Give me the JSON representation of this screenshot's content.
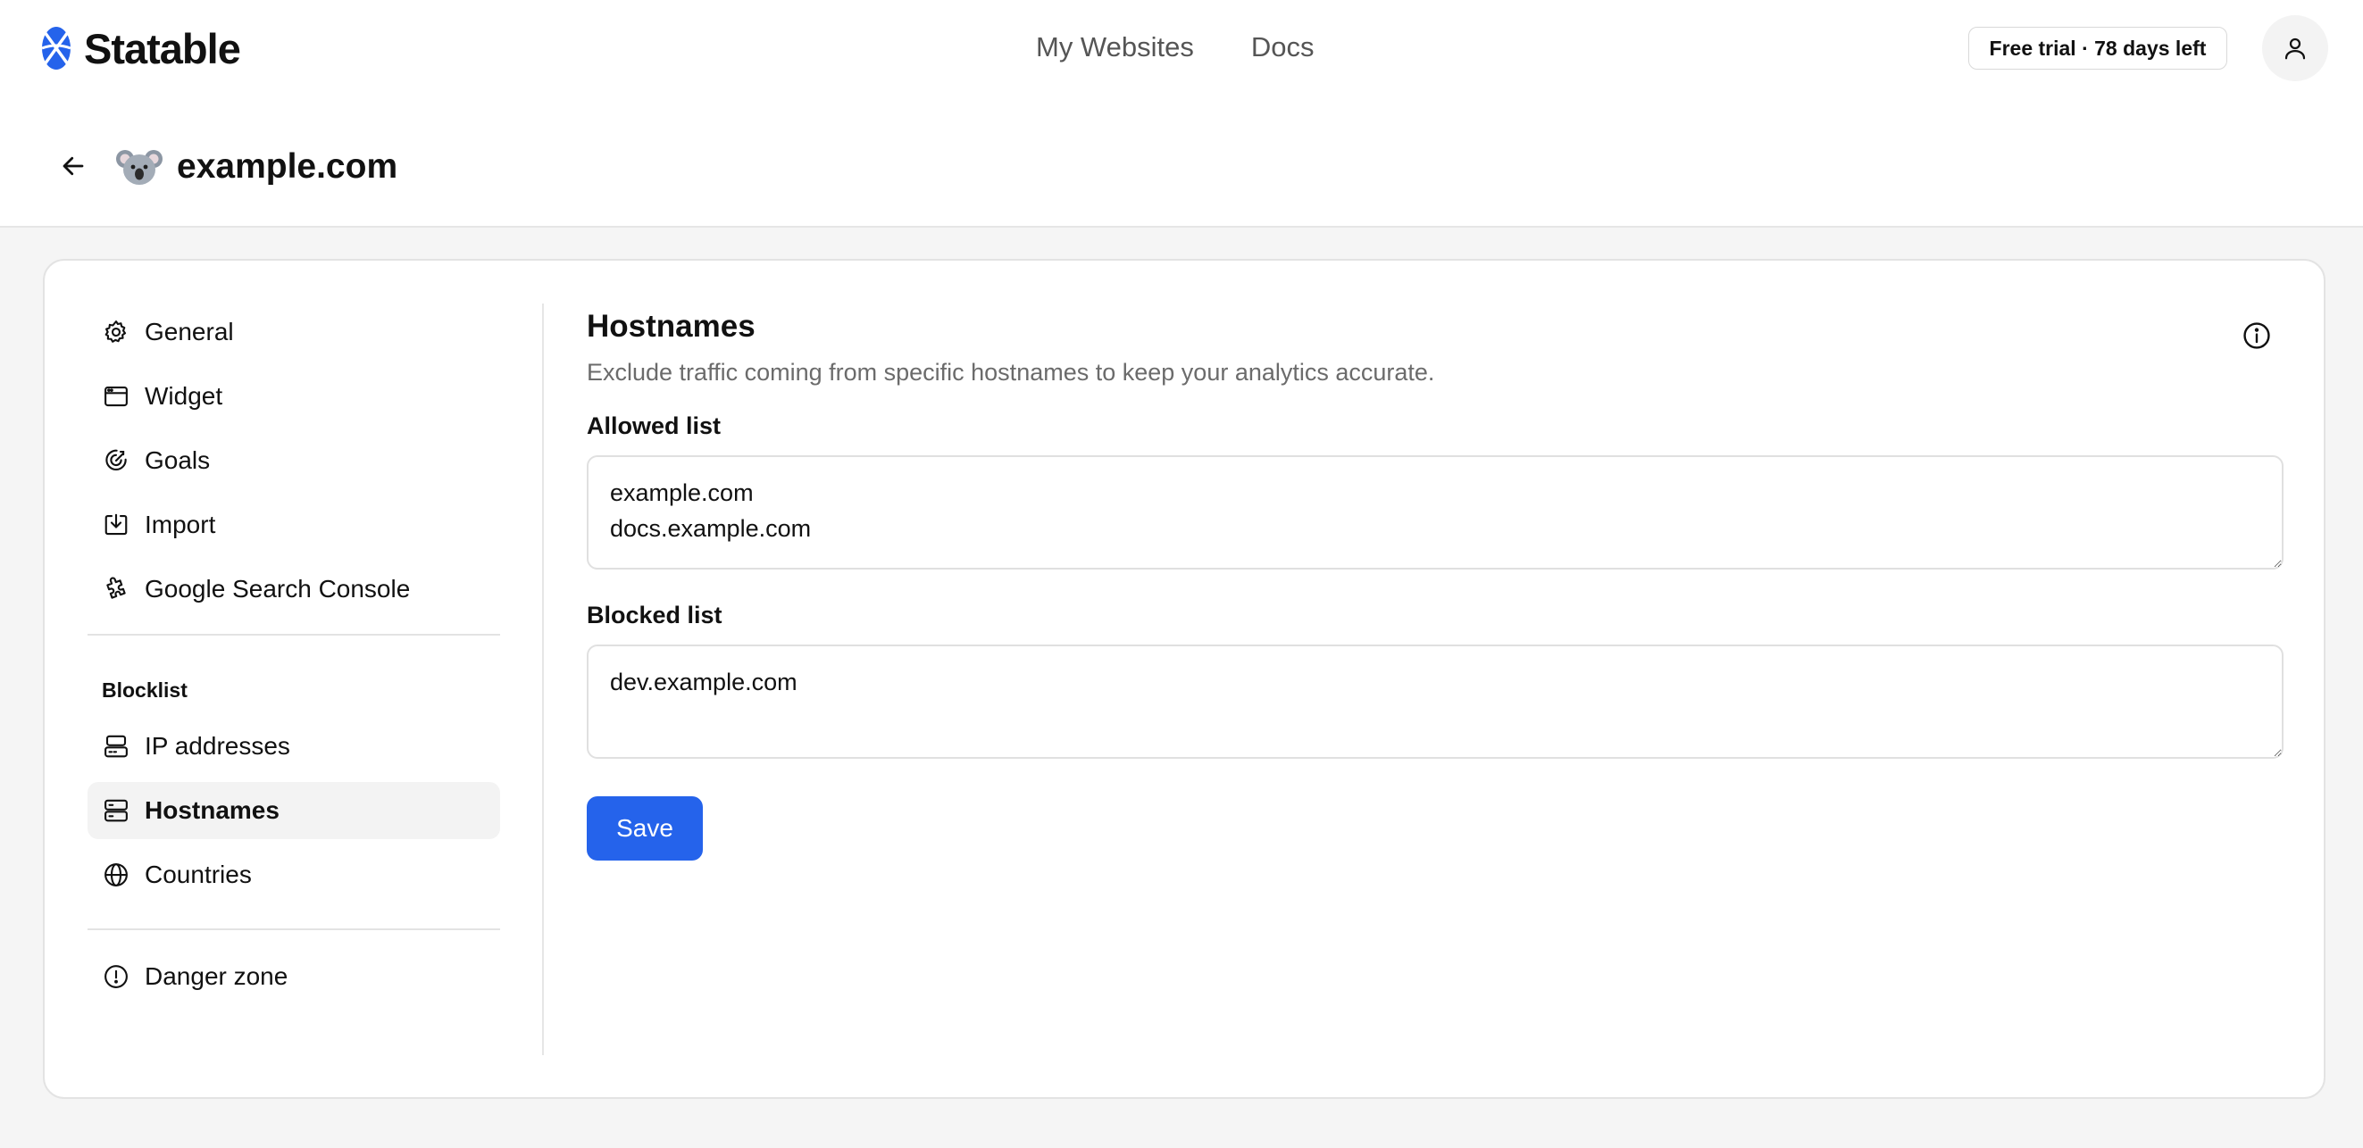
{
  "brand": {
    "name": "Statable",
    "accent": "#2563eb"
  },
  "nav": {
    "links": [
      {
        "label": "My Websites"
      },
      {
        "label": "Docs"
      }
    ],
    "trial_badge": "Free trial · 78 days left"
  },
  "icons": {
    "logo": "statable-logo-icon",
    "back": "arrow-left-icon",
    "user": "user-icon",
    "site": "koala-emoji-icon",
    "info": "info-circle-icon"
  },
  "site": {
    "name": "example.com"
  },
  "sidebar": {
    "items": [
      {
        "label": "General",
        "icon": "gear-icon"
      },
      {
        "label": "Widget",
        "icon": "window-icon"
      },
      {
        "label": "Goals",
        "icon": "target-icon"
      },
      {
        "label": "Import",
        "icon": "import-icon"
      },
      {
        "label": "Google Search Console",
        "icon": "puzzle-icon"
      }
    ],
    "blocklist_title": "Blocklist",
    "blocklist_items": [
      {
        "label": "IP addresses",
        "icon": "ip-server-icon",
        "active": false
      },
      {
        "label": "Hostnames",
        "icon": "server-icon",
        "active": true
      },
      {
        "label": "Countries",
        "icon": "globe-icon",
        "active": false
      }
    ],
    "danger": {
      "label": "Danger zone",
      "icon": "alert-circle-icon"
    }
  },
  "content": {
    "title": "Hostnames",
    "description": "Exclude traffic coming from specific hostnames to keep your analytics accurate.",
    "allowed_label": "Allowed list",
    "allowed_value": "example.com\ndocs.example.com",
    "blocked_label": "Blocked list",
    "blocked_value": "dev.example.com",
    "save_label": "Save"
  }
}
